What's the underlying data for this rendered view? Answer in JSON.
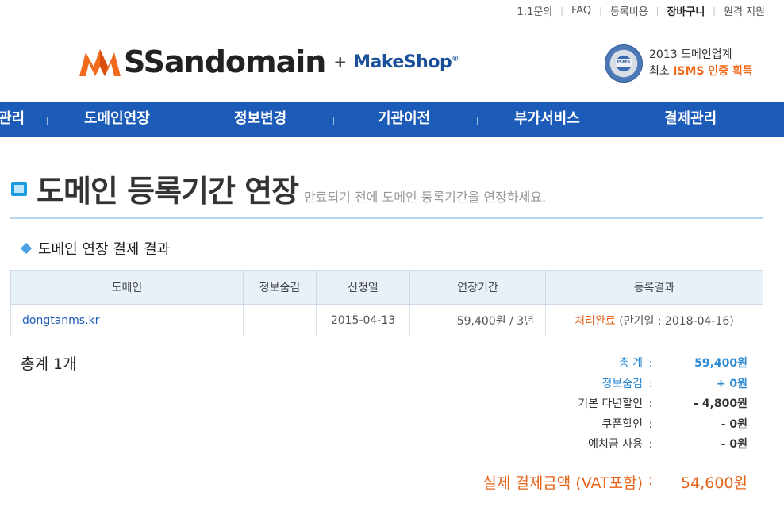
{
  "top_links": [
    "1:1문의",
    "FAQ",
    "등록비용",
    "장바구니",
    "원격 지원"
  ],
  "logo": {
    "brand": "SSandomain",
    "plus": "+",
    "partner": "MakeShop",
    "partner_mark": "®"
  },
  "isms": {
    "seal_text": "ISMS",
    "line1": "2013 도메인업계",
    "line2_prefix": "최초 ",
    "line2_highlight": "ISMS 인증 획득"
  },
  "nav": [
    "관리",
    "도메인연장",
    "정보변경",
    "기관이전",
    "부가서비스",
    "결제관리"
  ],
  "page": {
    "title": "도메인 등록기간 연장",
    "subtitle": "만료되기 전에 도메인 등록기간을 연장하세요."
  },
  "section_title": "도메인 연장 결제 결과",
  "table": {
    "headers": [
      "도메인",
      "정보숨김",
      "신청일",
      "연장기간",
      "등록결과"
    ],
    "rows": [
      {
        "domain": "dongtanms.kr",
        "privacy": "",
        "date": "2015-04-13",
        "period": "59,400원 / 3년",
        "status": "처리완료",
        "expiry": " (만기일 : 2018-04-16)"
      }
    ]
  },
  "total_count": "총계 1개",
  "summary": [
    {
      "label": "총 계",
      "value": "59,400원",
      "accent": true
    },
    {
      "label": "정보숨김",
      "value": "+ 0원",
      "accent": true
    },
    {
      "label": "기본 다년할인",
      "value": "- 4,800원",
      "accent": false
    },
    {
      "label": "쿠폰할인",
      "value": "- 0원",
      "accent": false
    },
    {
      "label": "예치금 사용",
      "value": "- 0원",
      "accent": false
    }
  ],
  "final": {
    "label": "실제 결제금액 (VAT포함)",
    "value": "54,600원"
  },
  "colon": ":",
  "colors": {
    "nav": "#1c5bb8",
    "accent_blue": "#2b8ad4",
    "accent_orange": "#e5641a",
    "logo_orange": "#f26a1b"
  },
  "icons": {
    "logo_mark": "ss-logo-icon",
    "seal": "isms-seal-icon",
    "title": "square-bullet-icon",
    "section": "diamond-bullet-icon"
  }
}
